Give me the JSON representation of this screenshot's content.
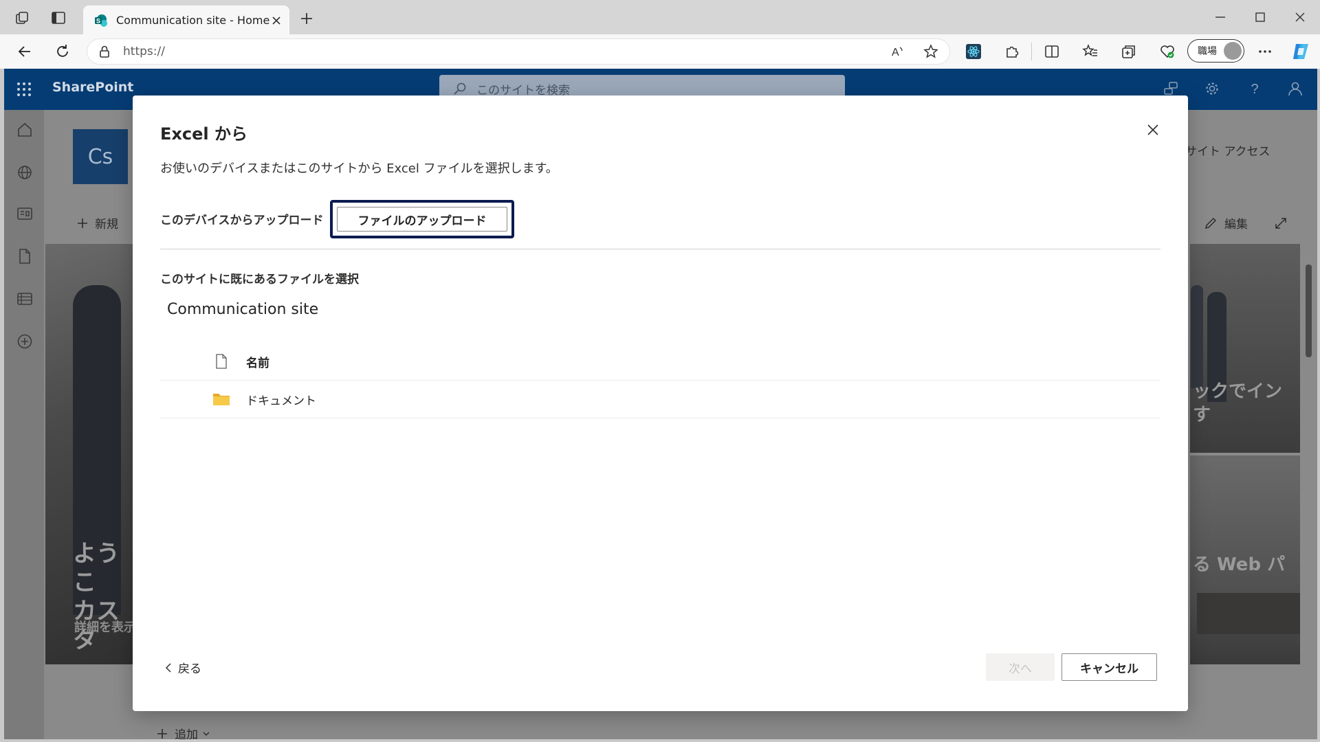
{
  "browser": {
    "tab_title": "Communication site - Home",
    "url": "https://",
    "profile_label": "職場"
  },
  "sharepoint": {
    "brand": "SharePoint",
    "search_placeholder": "このサイトを検索",
    "site_logo": "Cs",
    "new_label": "新規",
    "site_access_label": "サイト アクセス",
    "edit_label": "編集",
    "add_label": "追加",
    "hero_left_lines": [
      "ようこ",
      "カスタ"
    ],
    "hero_left_sub": "詳細を表示",
    "hero_right_top_lines": [
      "ックでイン",
      "す"
    ],
    "hero_right_bottom_text": "る Web パ"
  },
  "dialog": {
    "title": "Excel から",
    "description": "お使いのデバイスまたはこのサイトから Excel ファイルを選択します。",
    "device_label": "このデバイスからアップロード",
    "upload_button": "ファイルのアップロード",
    "site_select_label": "このサイトに既にあるファイルを選択",
    "site_name": "Communication site",
    "list_header_name": "名前",
    "rows": [
      {
        "name": "ドキュメント",
        "icon": "folder-icon"
      }
    ],
    "back_label": "戻る",
    "next_label": "次へ",
    "cancel_label": "キャンセル"
  },
  "colors": {
    "suitebar": "#053c74",
    "focus_ring": "#0b1b50",
    "folder": "#f2c94c"
  }
}
